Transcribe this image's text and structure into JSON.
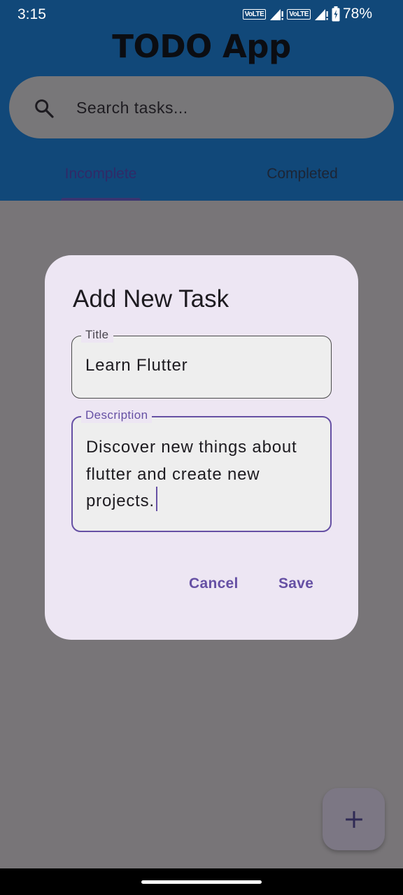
{
  "status_bar": {
    "time": "3:15",
    "sim1": "VoLTE",
    "sim2": "VoLTE",
    "battery": "78%"
  },
  "app": {
    "title": "TODO App"
  },
  "search": {
    "placeholder": "Search tasks...",
    "icon": "search-icon"
  },
  "tabs": [
    {
      "label": "Incomplete",
      "selected": true
    },
    {
      "label": "Completed",
      "selected": false
    }
  ],
  "dialog": {
    "title": "Add New Task",
    "title_field": {
      "label": "Title",
      "value": "Learn Flutter"
    },
    "description_field": {
      "label": "Description",
      "value": "Discover new things about flutter and create new projects."
    },
    "cancel_label": "Cancel",
    "save_label": "Save"
  },
  "fab": {
    "icon": "plus-icon"
  },
  "colors": {
    "header": "#114879",
    "accent": "#6650a4",
    "dialog_bg": "#ede6f3",
    "scrim": "#787578"
  }
}
